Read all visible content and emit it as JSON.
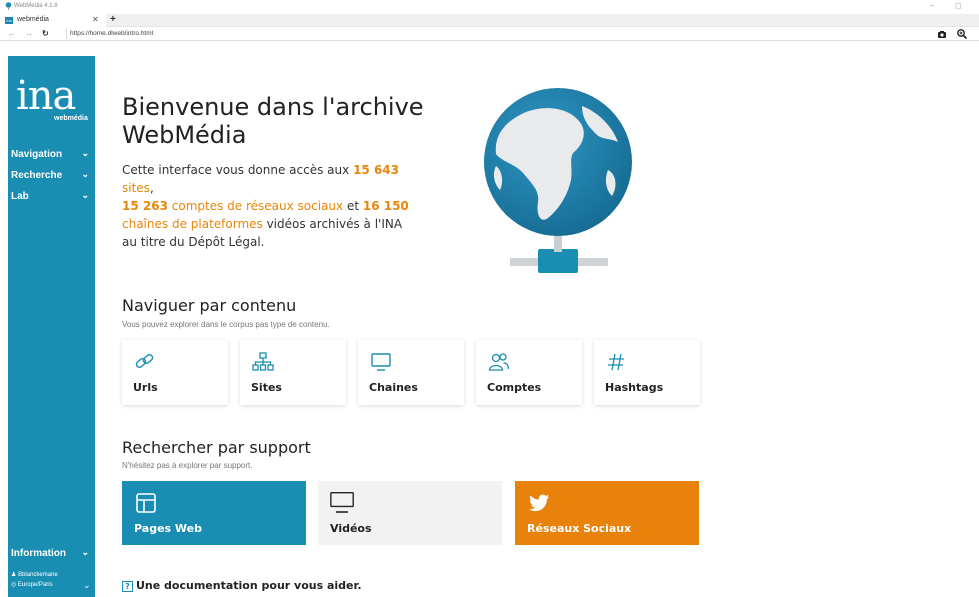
{
  "window": {
    "app_title": "WebMedia 4.1.8",
    "tab_label": "webmédia",
    "tab_favicon": "ina",
    "new_tab": "+",
    "url": "https://home.dlweb/intro.html"
  },
  "sidebar": {
    "brand": "ina",
    "brand_sub": "webmédia",
    "items": [
      {
        "label": "Navigation"
      },
      {
        "label": "Recherche"
      },
      {
        "label": "Lab"
      }
    ],
    "information_label": "Information",
    "user": "Bblanckemane",
    "timezone": "Europe/Paris"
  },
  "hero": {
    "title": "Bienvenue dans l'archive WebMédia",
    "text_1": "Cette interface vous donne accès aux ",
    "sites_count": "15 643",
    "sites_label": " sites",
    "text_2": ",",
    "accounts_count": "15 263",
    "accounts_label": " comptes de réseaux sociaux",
    "text_3": " et ",
    "channels_count": "16 150",
    "channels_label": "chaînes de plateformes",
    "text_4": " vidéos archivés à l'INA au titre du Dépôt Légal."
  },
  "content_section": {
    "title": "Naviguer par contenu",
    "subtitle": "Vous pouvez explorer dans le corpus pas type de contenu.",
    "cards": [
      {
        "label": "Urls",
        "icon": "link-icon"
      },
      {
        "label": "Sites",
        "icon": "sitemap-icon"
      },
      {
        "label": "Chaines",
        "icon": "monitor-icon"
      },
      {
        "label": "Comptes",
        "icon": "users-icon"
      },
      {
        "label": "Hashtags",
        "icon": "hashtag-icon"
      }
    ]
  },
  "support_section": {
    "title": "Rechercher par support",
    "subtitle": "N'hésitez pas à explorer par support.",
    "items": [
      {
        "label": "Pages Web",
        "icon": "layout-icon",
        "bg": "#1a8db3",
        "fg": "#ffffff"
      },
      {
        "label": "Vidéos",
        "icon": "monitor-icon",
        "bg": "#f2f2f2",
        "fg": "#222222"
      },
      {
        "label": "Réseaux Sociaux",
        "icon": "twitter-icon",
        "bg": "#e9820a",
        "fg": "#ffffff"
      }
    ]
  },
  "doc_link": "Une documentation pour vous aider.",
  "colors": {
    "accent": "#1a8db3",
    "highlight": "#e9860a",
    "social": "#e9820a"
  }
}
